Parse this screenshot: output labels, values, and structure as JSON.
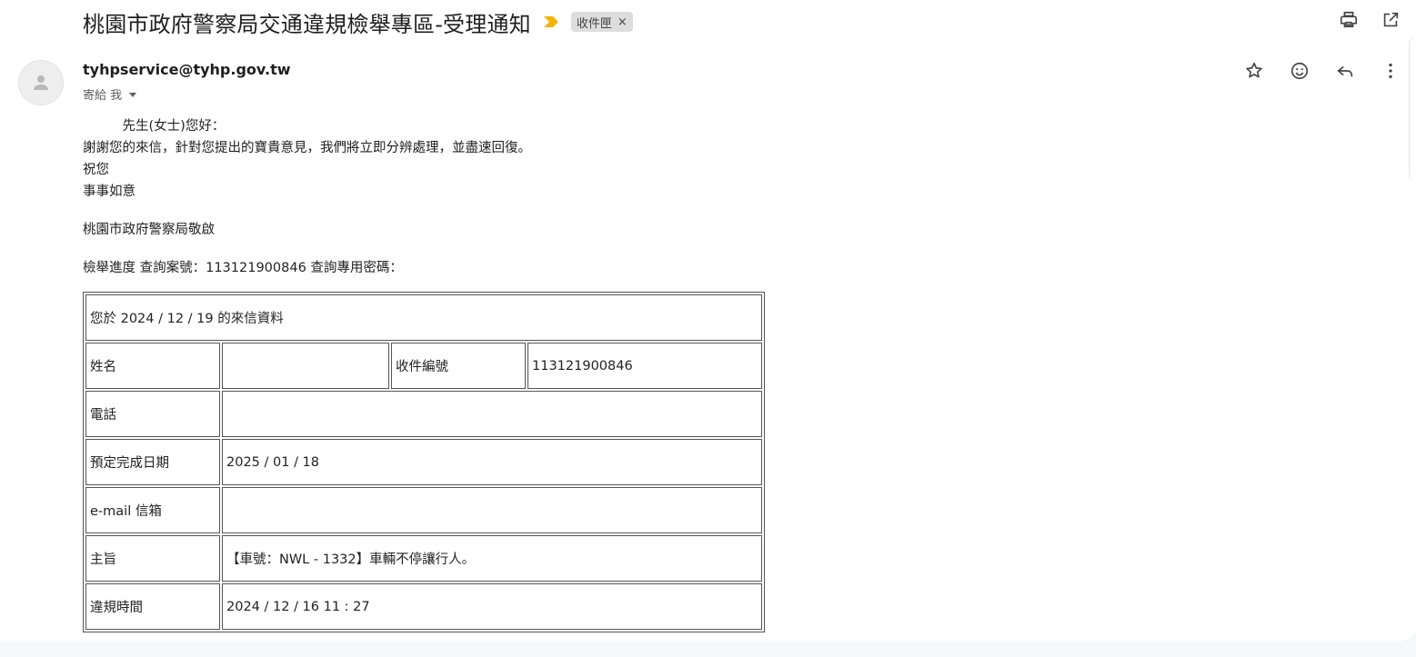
{
  "email": {
    "subject": "桃園市政府警察局交通違規檢舉專區-受理通知",
    "label": "收件匣",
    "label_close": "×",
    "sender": "tyhpservice@tyhp.gov.tw",
    "recipient": "寄給 我",
    "body": {
      "greeting": "　　　先生(女士)您好：",
      "line1": "謝謝您的來信，針對您提出的寶貴意見，我們將立即分辨處理，並盡速回復。",
      "line2": "祝您",
      "line3": "事事如意",
      "signature": "桃園市政府警察局敬啟",
      "progress": "檢舉進度 查詢案號：113121900846 查詢專用密碼："
    },
    "table": {
      "header": "您於 2024 / 12 / 19 的來信資料",
      "name_label": "姓名",
      "name_value": "",
      "case_label": "收件編號",
      "case_value": "113121900846",
      "phone_label": "電話",
      "phone_value": "",
      "due_label": "預定完成日期",
      "due_value": "2025 / 01 / 18",
      "email_label": "e-mail 信箱",
      "email_value": "",
      "subject_label": "主旨",
      "subject_value": "【車號：NWL - 1332】車輛不停讓行人。",
      "time_label": "違規時間",
      "time_value": "2024 / 12 / 16 11 : 27"
    }
  },
  "icons": {
    "importance": "importance-marker-icon",
    "print": "print-icon",
    "open_new_window": "open-in-new-window-icon",
    "star": "star-icon",
    "emoji": "emoji-reaction-icon",
    "reply": "reply-icon",
    "more": "more-vertical-icon",
    "avatar": "person-icon",
    "dropdown": "dropdown-arrow-icon"
  },
  "colors": {
    "importance": "#f4b400",
    "label_bg": "#dddddd",
    "background": "#f6f8fc"
  }
}
